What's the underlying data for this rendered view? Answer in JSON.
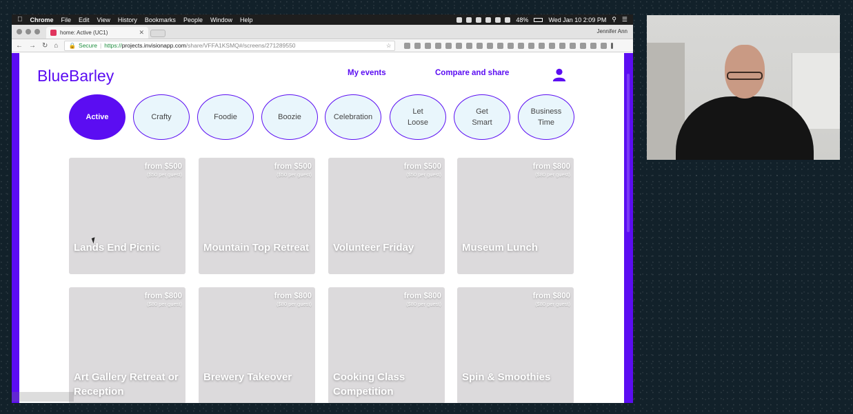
{
  "menubar": {
    "app_name": "Chrome",
    "items": [
      "File",
      "Edit",
      "View",
      "History",
      "Bookmarks",
      "People",
      "Window",
      "Help"
    ],
    "battery": "48%",
    "datetime": "Wed Jan 10  2:09 PM"
  },
  "browser": {
    "tab_title": "home: Active (UC1)",
    "profile_name": "Jennifer Ann",
    "secure_label": "Secure",
    "url_scheme": "https://",
    "url_host": "projects.invisionapp.com",
    "url_path": "/share/VFFA1KSMQ#/screens/271289550"
  },
  "site": {
    "brand": "BlueBarley",
    "nav": {
      "my_events": "My events",
      "compare_share": "Compare and share"
    },
    "user_icon": "user-icon"
  },
  "categories": [
    {
      "label": "Active",
      "active": true
    },
    {
      "label": "Crafty",
      "active": false
    },
    {
      "label": "Foodie",
      "active": false
    },
    {
      "label": "Boozie",
      "active": false
    },
    {
      "label": "Celebration",
      "active": false
    },
    {
      "label": "Let\nLoose",
      "active": false
    },
    {
      "label": "Get\nSmart",
      "active": false
    },
    {
      "label": "Business\nTime",
      "active": false
    }
  ],
  "cards": [
    {
      "title": "Lands End Picnic",
      "price": "from $500",
      "per_guest": "($50 per guest)"
    },
    {
      "title": "Mountain Top Retreat",
      "price": "from $500",
      "per_guest": "($50 per guest)"
    },
    {
      "title": "Volunteer Friday",
      "price": "from $500",
      "per_guest": "($50 per guest)"
    },
    {
      "title": "Museum Lunch",
      "price": "from $800",
      "per_guest": "($80 per guest)"
    },
    {
      "title": "Art Gallery Retreat or Reception",
      "price": "from $800",
      "per_guest": "($80 per guest)"
    },
    {
      "title": "Brewery Takeover",
      "price": "from $800",
      "per_guest": "($80 per guest)"
    },
    {
      "title": "Cooking Class Competition",
      "price": "from $800",
      "per_guest": "($80 per guest)"
    },
    {
      "title": "Spin & Smoothies",
      "price": "from $800",
      "per_guest": "($80 per guest)"
    }
  ],
  "colors": {
    "brand": "#5b0df2",
    "category_bg": "#e9f6fc",
    "card_bg": "#dcdadc"
  }
}
